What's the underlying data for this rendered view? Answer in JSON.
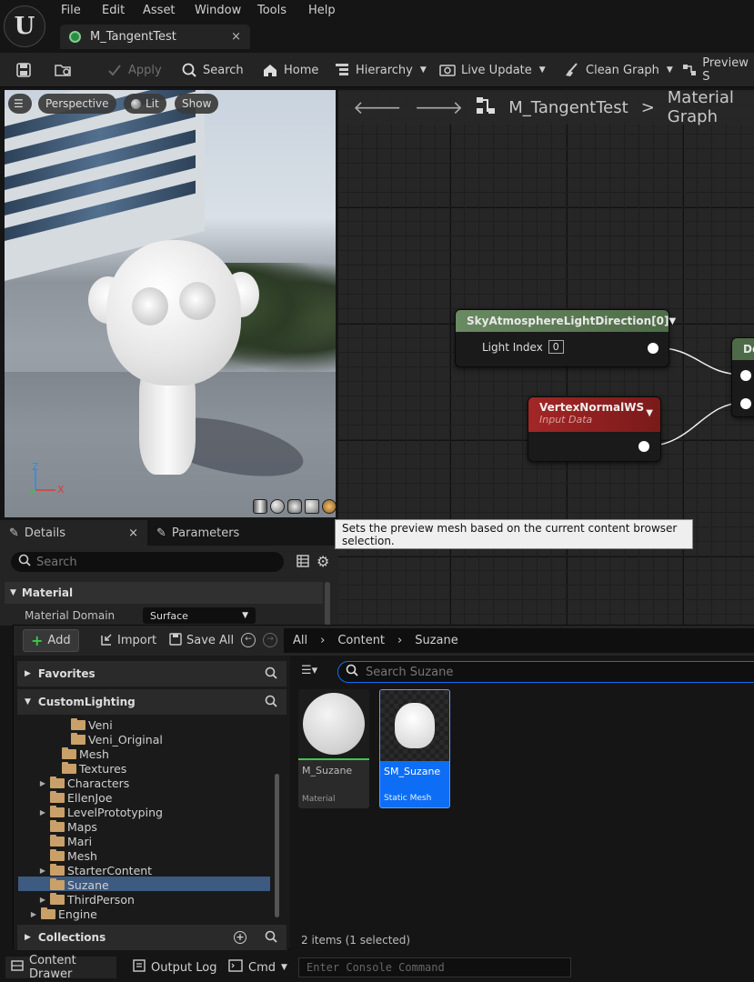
{
  "menu": {
    "file": "File",
    "edit": "Edit",
    "asset": "Asset",
    "window": "Window",
    "tools": "Tools",
    "help": "Help"
  },
  "tab": {
    "title": "M_TangentTest",
    "close": "×"
  },
  "toolbar": {
    "apply": "Apply",
    "search": "Search",
    "home": "Home",
    "hierarchy": "Hierarchy",
    "live_update": "Live Update",
    "clean_graph": "Clean Graph",
    "preview": "Preview S"
  },
  "viewport": {
    "perspective": "Perspective",
    "lit": "Lit",
    "show": "Show",
    "axis_z": "Z",
    "axis_x": "X"
  },
  "graph": {
    "breadcrumb_asset": "M_TangentTest",
    "breadcrumb_sep": ">",
    "breadcrumb_graph": "Material Graph",
    "node1_title": "SkyAtmosphereLightDirection[0]",
    "node1_param_label": "Light Index",
    "node1_param_value": "0",
    "node2_title": "VertexNormalWS",
    "node2_subtitle": "Input Data",
    "node3_title": "Do"
  },
  "tooltip": "Sets the preview mesh based on the current content browser selection.",
  "details": {
    "tab_details": "Details",
    "tab_close": "×",
    "tab_parameters": "Parameters",
    "search_placeholder": "Search",
    "category": "Material",
    "prop_label": "Material Domain",
    "prop_value": "Surface"
  },
  "drawer": {
    "add": "Add",
    "import": "Import",
    "save_all": "Save All",
    "path": [
      "All",
      "Content",
      "Suzane"
    ],
    "favorites": "Favorites",
    "root": "CustomLighting",
    "collections": "Collections",
    "search_placeholder": "Search Suzane",
    "tree": [
      "Veni",
      "Veni_Original",
      "Mesh",
      "Textures",
      "Characters",
      "EllenJoe",
      "LevelPrototyping",
      "Maps",
      "Mari",
      "Mesh",
      "StarterContent",
      "Suzane",
      "ThirdPerson",
      "Engine"
    ],
    "assets": [
      {
        "name": "M_Suzane",
        "type": "Material"
      },
      {
        "name": "SM_Suzane",
        "type": "Static Mesh"
      }
    ],
    "item_count": "2 items (1 selected)"
  },
  "statusbar": {
    "content_drawer": "Content Drawer",
    "output_log": "Output Log",
    "cmd": "Cmd",
    "console_placeholder": "Enter Console Command"
  },
  "colors": {
    "accent": "#0d6ef5",
    "selection": "#3d5a80",
    "node_green": "#5d7d55",
    "node_red": "#8a1f1f"
  }
}
